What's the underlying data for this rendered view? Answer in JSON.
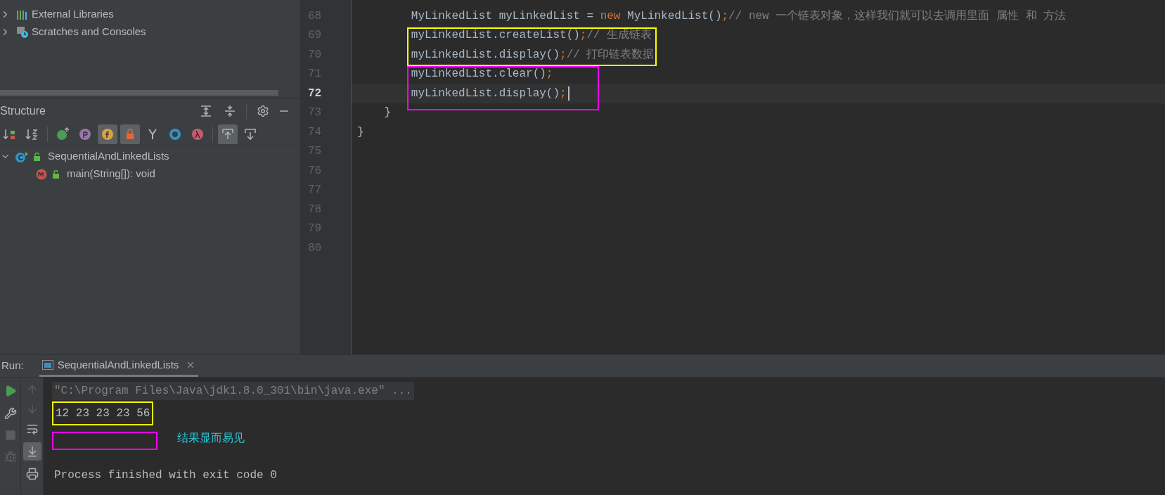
{
  "project_tree": {
    "items": [
      {
        "label": "External Libraries",
        "kind": "libraries",
        "expanded": false
      },
      {
        "label": "Scratches and Consoles",
        "kind": "scratches",
        "expanded": false
      }
    ]
  },
  "structure": {
    "title": "Structure",
    "toolbar": [
      {
        "selected": false
      },
      {
        "selected": false
      },
      {
        "selected": false
      },
      {
        "selected": false
      },
      {
        "selected": true
      },
      {
        "selected": true
      },
      {
        "selected": false
      },
      {
        "selected": false
      },
      {
        "selected": false
      },
      {
        "selected": true
      },
      {
        "selected": false
      }
    ],
    "tree": [
      {
        "label": "SequentialAndLinkedLists",
        "kind": "class",
        "expanded": true,
        "children": [
          {
            "label": "main(String[]): void",
            "kind": "method"
          }
        ]
      }
    ]
  },
  "editor": {
    "lines": [
      {
        "number": "68",
        "current": false,
        "segments": [
          {
            "text": "        MyLinkedList myLinkedList = ",
            "kind": "plain"
          },
          {
            "text": "new",
            "kind": "keyword"
          },
          {
            "text": " MyLinkedList()",
            "kind": "plain"
          },
          {
            "text": ";",
            "kind": "keyword"
          },
          {
            "text": "// new 一个链表对象，这样我们就可以去调用里面 属性 和 方法",
            "kind": "comment"
          }
        ]
      },
      {
        "number": "69",
        "current": false,
        "color": "#ffff00",
        "segments": [
          {
            "text": "        myLinkedList.createList()",
            "kind": "plain"
          },
          {
            "text": ";",
            "kind": "keyword"
          },
          {
            "text": "// 生成链表",
            "kind": "comment"
          }
        ]
      },
      {
        "number": "70",
        "current": false,
        "color": "#ffff00",
        "segments": [
          {
            "text": "        myLinkedList.display()",
            "kind": "plain"
          },
          {
            "text": ";",
            "kind": "keyword"
          },
          {
            "text": "// 打印链表数据",
            "kind": "comment"
          }
        ]
      },
      {
        "number": "71",
        "current": false,
        "color": "#ff00ff",
        "segments": [
          {
            "text": "        myLinkedList.clear()",
            "kind": "plain"
          },
          {
            "text": ";",
            "kind": "keyword"
          }
        ]
      },
      {
        "number": "72",
        "current": true,
        "color": "#ff00ff",
        "segments": [
          {
            "text": "        myLinkedList.display()",
            "kind": "plain"
          },
          {
            "text": ";",
            "kind": "keyword"
          }
        ]
      },
      {
        "number": "73",
        "current": false,
        "segments": [
          {
            "text": "    }",
            "kind": "plain"
          }
        ]
      },
      {
        "number": "74",
        "current": false,
        "segments": [
          {
            "text": "}",
            "kind": "plain"
          }
        ]
      },
      {
        "number": "75",
        "current": false
      },
      {
        "number": "76",
        "current": false
      },
      {
        "number": "77",
        "current": false
      },
      {
        "number": "78",
        "current": false
      },
      {
        "number": "79",
        "current": false
      },
      {
        "number": "80",
        "current": false
      }
    ]
  },
  "run": {
    "label": "Run:",
    "tabs": [
      {
        "label": "SequentialAndLinkedLists",
        "selected": true
      }
    ],
    "console": [
      {
        "kind": "command",
        "text": "\"C:\\Program Files\\Java\\jdk1.8.0_301\\bin\\java.exe\" ..."
      },
      {
        "kind": "output",
        "text": "12 23 23 23 56",
        "color": "#ffff00"
      },
      {
        "kind": "blank",
        "color": "#ff00ff",
        "note": "结果显而易见"
      },
      {
        "kind": "output",
        "text": "Process finished with exit code 0"
      }
    ]
  }
}
